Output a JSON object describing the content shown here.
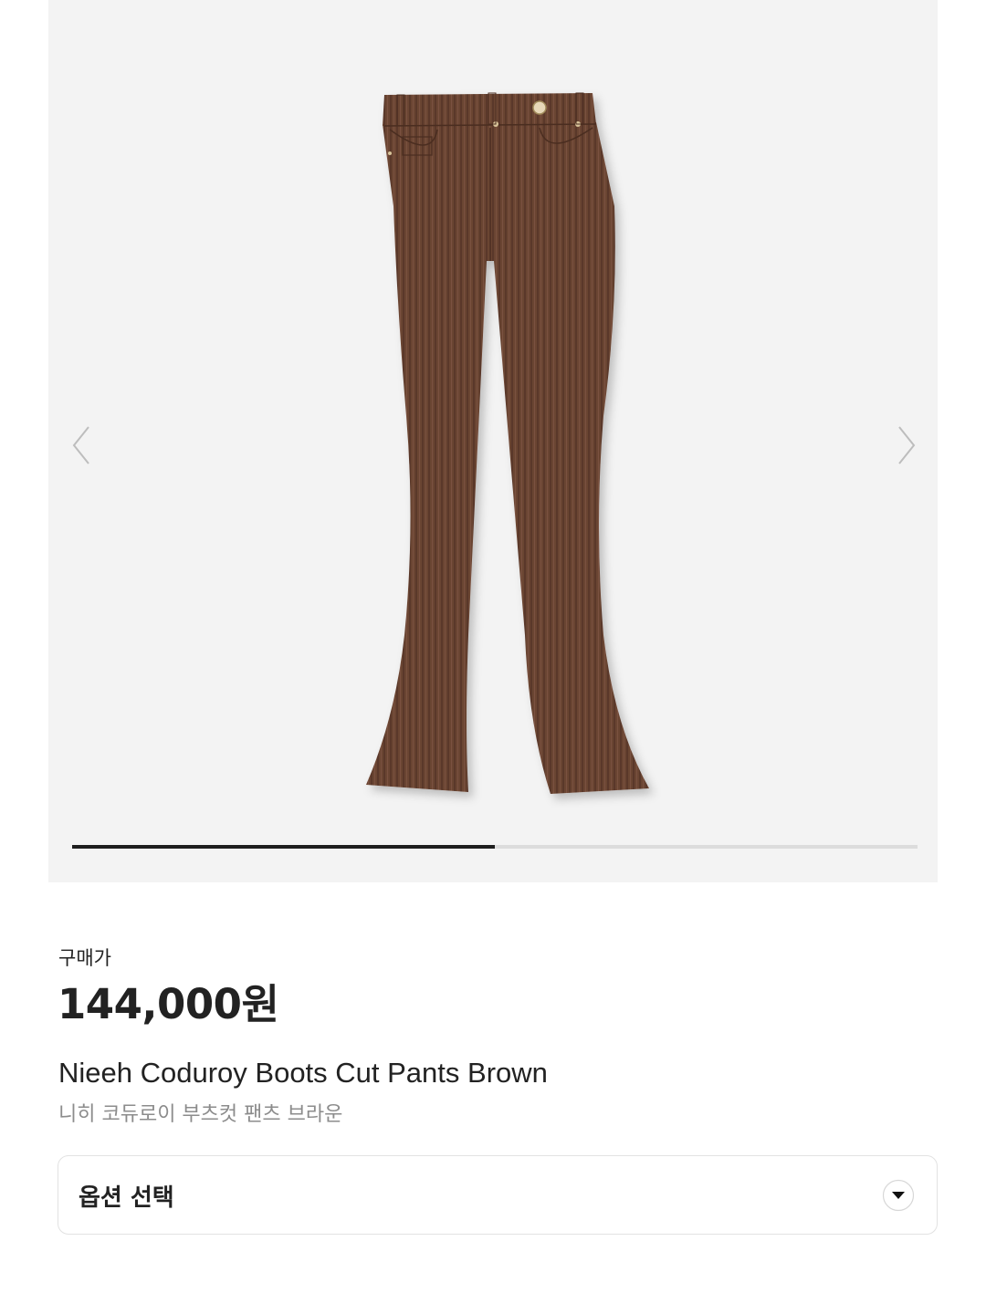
{
  "gallery": {
    "image_alt": "Nieeh Coduroy Boots Cut Pants Brown",
    "prev_icon": "chevron-left-icon",
    "next_icon": "chevron-right-icon",
    "progress_fraction": 0.5,
    "product_color": "#6b4433"
  },
  "price": {
    "label": "구매가",
    "value": "144,000원"
  },
  "product": {
    "name_en": "Nieeh Coduroy Boots Cut Pants Brown",
    "name_ko": "니히 코듀로이 부츠컷 팬츠 브라운"
  },
  "option": {
    "label": "옵션 선택",
    "icon": "chevron-down-circle-icon"
  }
}
